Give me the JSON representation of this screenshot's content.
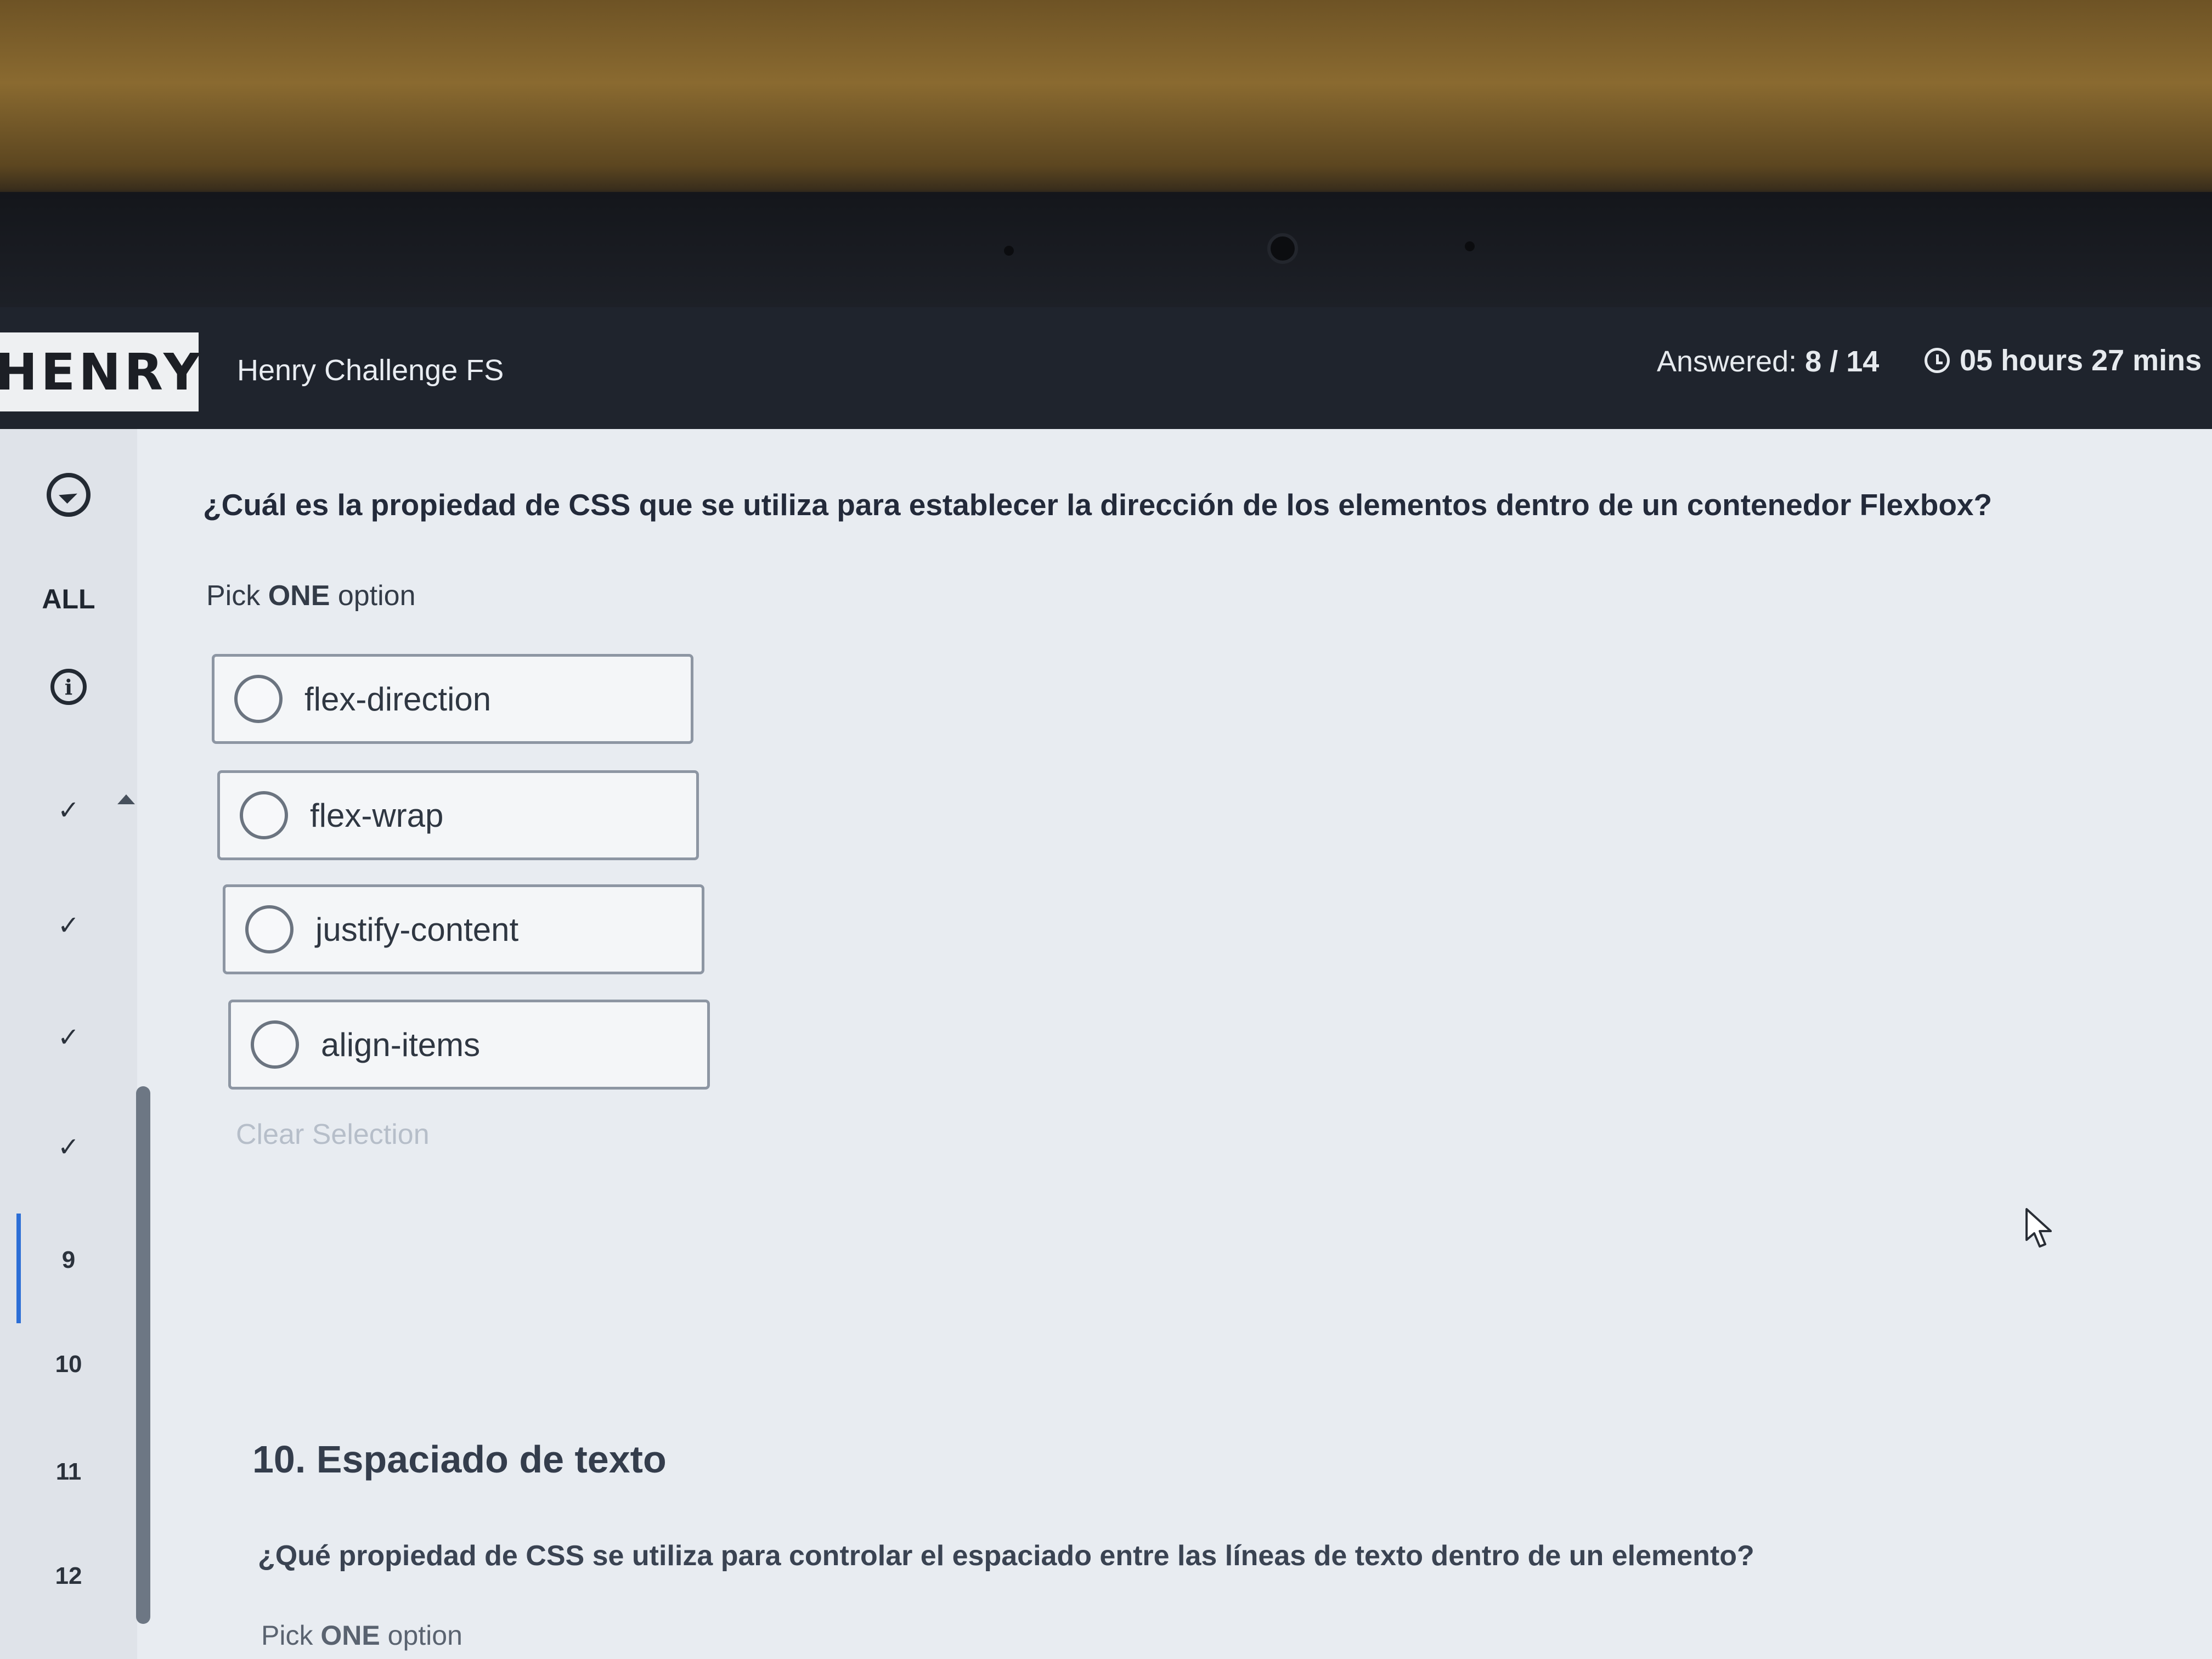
{
  "header": {
    "logo": "HENRY",
    "app_title": "Henry Challenge FS",
    "answered_label": "Answered:",
    "answered_value": "8 / 14",
    "timer": "05 hours 27 mins"
  },
  "sidebar": {
    "all_label": "ALL",
    "checks": [
      "✓",
      "✓",
      "✓",
      "✓"
    ],
    "numbers": [
      "9",
      "10",
      "11",
      "12"
    ]
  },
  "question": {
    "text": "¿Cuál es la propiedad de CSS que se utiliza para establecer la dirección de los elementos dentro de un contenedor Flexbox?",
    "pick_prefix": "Pick",
    "pick_bold": "ONE",
    "pick_suffix": "option",
    "options": [
      "flex-direction",
      "flex-wrap",
      "justify-content",
      "align-items"
    ],
    "clear_label": "Clear Selection"
  },
  "next_section": {
    "title": "10. Espaciado de texto",
    "question": "¿Qué propiedad de CSS se utiliza para controlar el espaciado entre las líneas de texto dentro de un elemento?",
    "pick_prefix": "Pick",
    "pick_bold": "ONE",
    "pick_suffix": "option"
  }
}
